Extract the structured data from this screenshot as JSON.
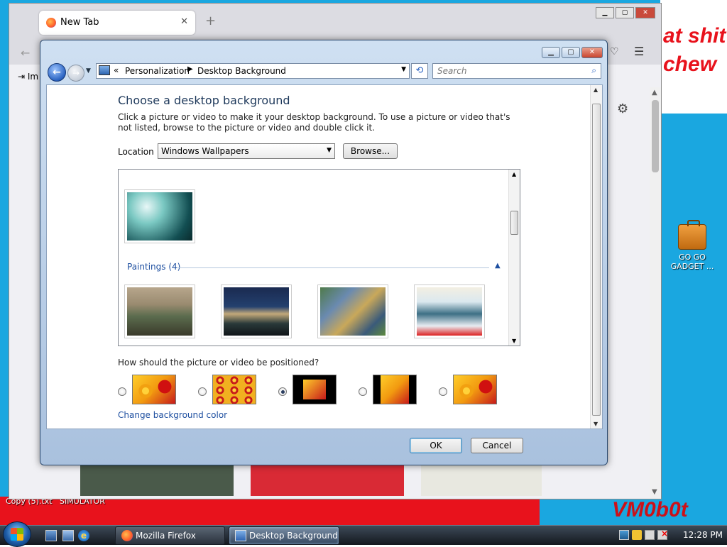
{
  "desktop": {
    "wallpaper_text_1": "at shit",
    "wallpaper_text_2": "chew",
    "signature": "VM0b0t",
    "icon_label": "GO GO GADGET ...",
    "bottom_label_1": "Copy (5).txt",
    "bottom_label_2": "SIMULATOR"
  },
  "firefox": {
    "tab_title": "New Tab",
    "import_text": "Im"
  },
  "window": {
    "address": {
      "segments": [
        "Personalization",
        "Desktop Background"
      ]
    },
    "search_placeholder": "Search",
    "title": "Choose a desktop background",
    "description": "Click a picture or video to make it your desktop background. To use a picture or video that's not listed, browse to the picture or video and double click it.",
    "location_label": "Location",
    "location_value": "Windows Wallpapers",
    "browse_label": "Browse...",
    "gallery": {
      "group_label": "Paintings (4)"
    },
    "position_question": "How should the picture or video be positioned?",
    "position_options": [
      "Fill",
      "Tile",
      "Center",
      "Fit",
      "Stretch"
    ],
    "position_selected": "Center",
    "change_color_label": "Change background color",
    "ok_label": "OK",
    "cancel_label": "Cancel"
  },
  "taskbar": {
    "tasks": [
      {
        "label": "Mozilla Firefox"
      },
      {
        "label": "Desktop Background"
      }
    ],
    "clock": "12:28 PM"
  }
}
